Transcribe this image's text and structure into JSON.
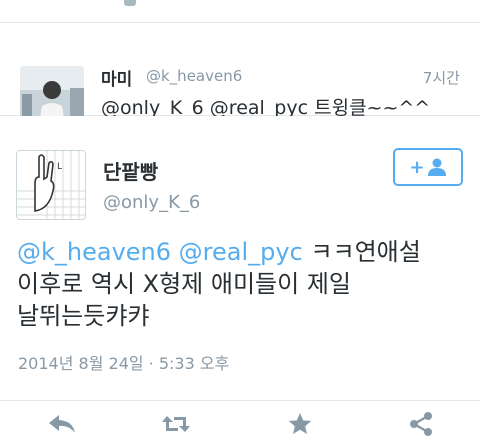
{
  "reply_tweet": {
    "name": "마미",
    "handle": "@k_heaven6",
    "time": "7시간",
    "mention1": "@only_K_6",
    "mention2": "@real_pyc",
    "text_suffix": "트윙클~~^^"
  },
  "main_tweet": {
    "name": "단팥빵",
    "handle": "@only_K_6",
    "mention1": "@k_heaven6",
    "mention2": "@real_pyc",
    "text_line1_suffix": "ㅋㅋ연애설",
    "text_line2": "이후로 역시 X형제 애미들이 제일",
    "text_line3": "날뛰는듯캬캬",
    "timestamp": "2014년 8월 24일 · 5:33 오후"
  },
  "actions": {
    "icons": [
      "reply-icon",
      "retweet-icon",
      "favorite-icon",
      "share-icon"
    ]
  },
  "colors": {
    "accent": "#55acee",
    "text": "#292f33",
    "muted": "#8899a6",
    "icon": "#8899a6"
  }
}
